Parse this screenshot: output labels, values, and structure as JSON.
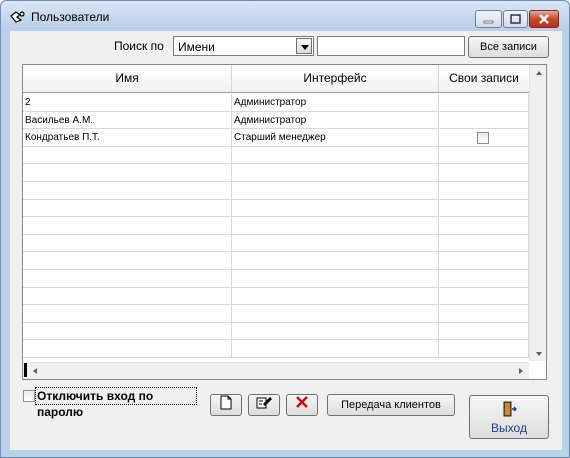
{
  "window": {
    "title": "Пользователи",
    "icon": "users-app-icon"
  },
  "search": {
    "label": "Поиск по",
    "field_value": "Имени",
    "query_value": "",
    "all_records_label": "Все записи"
  },
  "table": {
    "columns": [
      "Имя",
      "Интерфейс",
      "Свои записи"
    ],
    "rows": [
      {
        "name": "2",
        "interface": "Администратор",
        "own_records_checkbox": false
      },
      {
        "name": "Васильев А.М.",
        "interface": "Администратор",
        "own_records_checkbox": false
      },
      {
        "name": "Кондратьев П.Т.",
        "interface": "Старший менеджер",
        "own_records_checkbox": true
      }
    ],
    "empty_rows": 12
  },
  "options": {
    "disable_password_label": "Отключить вход по паролю",
    "disable_password_checked": false
  },
  "toolbar": {
    "new_icon": "new-document-icon",
    "edit_icon": "edit-icon",
    "delete_icon": "delete-x-icon",
    "transfer_label": "Передача клиентов"
  },
  "exit": {
    "label": "Выход",
    "icon": "exit-door-icon"
  },
  "colors": {
    "window_frame": "#b9d1ea",
    "client_bg": "#f0f0f0",
    "close_button": "#c9452c",
    "delete_icon": "#cc0000",
    "exit_text": "#1c3d8a"
  }
}
